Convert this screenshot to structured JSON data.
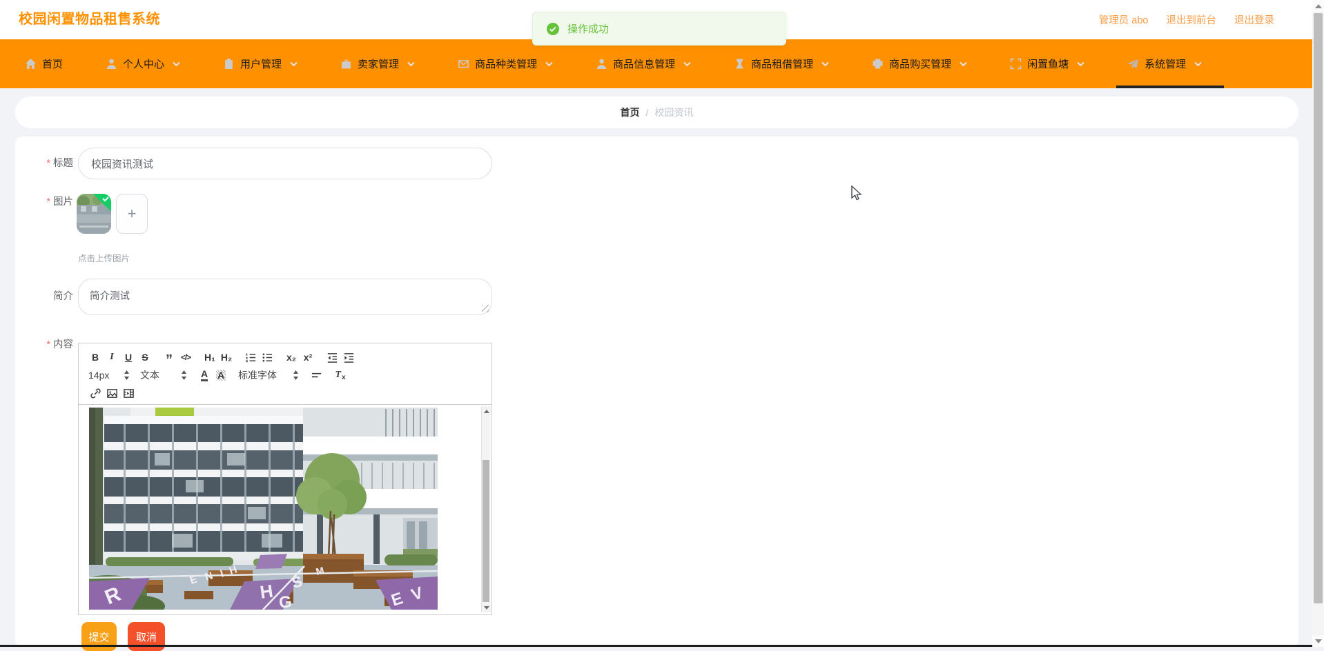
{
  "app": {
    "title": "校园闲置物品租售系统"
  },
  "userbar": {
    "admin": "管理员 abo",
    "to_front": "退出到前台",
    "logout": "退出登录"
  },
  "toast": {
    "message": "操作成功"
  },
  "nav": {
    "items": [
      {
        "label": "首页",
        "icon": "home-icon",
        "dropdown": false,
        "active": false
      },
      {
        "label": "个人中心",
        "icon": "user-icon",
        "dropdown": true,
        "active": false
      },
      {
        "label": "用户管理",
        "icon": "clipboard-icon",
        "dropdown": true,
        "active": false
      },
      {
        "label": "卖家管理",
        "icon": "briefcase-icon",
        "dropdown": true,
        "active": false
      },
      {
        "label": "商品种类管理",
        "icon": "mail-icon",
        "dropdown": true,
        "active": false
      },
      {
        "label": "商品信息管理",
        "icon": "person-icon",
        "dropdown": true,
        "active": false
      },
      {
        "label": "商品租借管理",
        "icon": "hourglass-icon",
        "dropdown": true,
        "active": false
      },
      {
        "label": "商品购买管理",
        "icon": "printer-icon",
        "dropdown": true,
        "active": false
      },
      {
        "label": "闲置鱼塘",
        "icon": "scan-icon",
        "dropdown": true,
        "active": false
      },
      {
        "label": "系统管理",
        "icon": "send-icon",
        "dropdown": true,
        "active": true
      }
    ]
  },
  "breadcrumb": {
    "home": "首页",
    "separator": "/",
    "current": "校园资讯"
  },
  "form": {
    "required_mark": "*",
    "title_label": "标题",
    "title_value": "校园资讯测试",
    "image_label": "图片",
    "upload_plus": "+",
    "upload_hint": "点击上传图片",
    "intro_label": "简介",
    "intro_value": "简介测试",
    "content_label": "内容",
    "submit": "提交",
    "cancel": "取消"
  },
  "editor_toolbar": {
    "bold": "B",
    "italic": "I",
    "underline": "U",
    "strike": "S",
    "code": "</>",
    "h1": "H₁",
    "h2": "H₂",
    "subscript": "x₂",
    "superscript": "x²",
    "size": "14px",
    "paragraph": "文本",
    "font": "标准字体",
    "color_letter": "A",
    "background_letter": "A",
    "clean_t": "T",
    "clean_x": "x"
  },
  "colors": {
    "accent_orange": "#ff9100",
    "nav_bg": "#ff9000",
    "success_text": "#67c23a",
    "success_bg": "#f0f9eb",
    "submit_bg": "#f8a117",
    "cancel_bg": "#f4502a"
  }
}
